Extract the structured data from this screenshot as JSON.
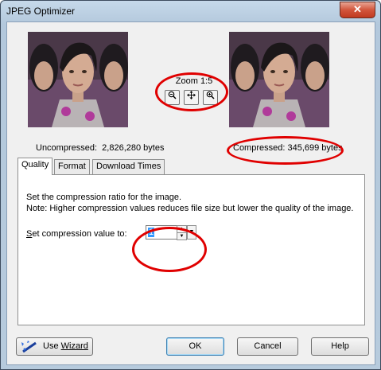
{
  "window": {
    "title": "JPEG Optimizer",
    "close_glyph": "✕"
  },
  "preview": {
    "zoom_label": "Zoom 1:5",
    "zoom_out_icon": "zoom-out-icon",
    "pan_icon": "pan-icon",
    "zoom_in_icon": "zoom-in-icon",
    "uncompressed_label": "Uncompressed:",
    "uncompressed_value": "2,826,280 bytes",
    "compressed_label": "Compressed:",
    "compressed_value": "345,699 bytes"
  },
  "tabs": [
    {
      "label": "Quality",
      "active": true
    },
    {
      "label": "Format",
      "active": false
    },
    {
      "label": "Download Times",
      "active": false
    }
  ],
  "quality": {
    "description": "Set the compression ratio for the image.",
    "note": "Note:  Higher compression values reduces file size but lower the quality of the image.",
    "compression_label_prefix": "S",
    "compression_label_rest": "et compression value to:",
    "compression_value": "1"
  },
  "buttons": {
    "wizard_prefix": "Use ",
    "wizard_label": "Wizard",
    "ok": "OK",
    "cancel": "Cancel",
    "help": "Help"
  },
  "colors": {
    "highlight": "#e00000",
    "selection": "#3399ff"
  }
}
